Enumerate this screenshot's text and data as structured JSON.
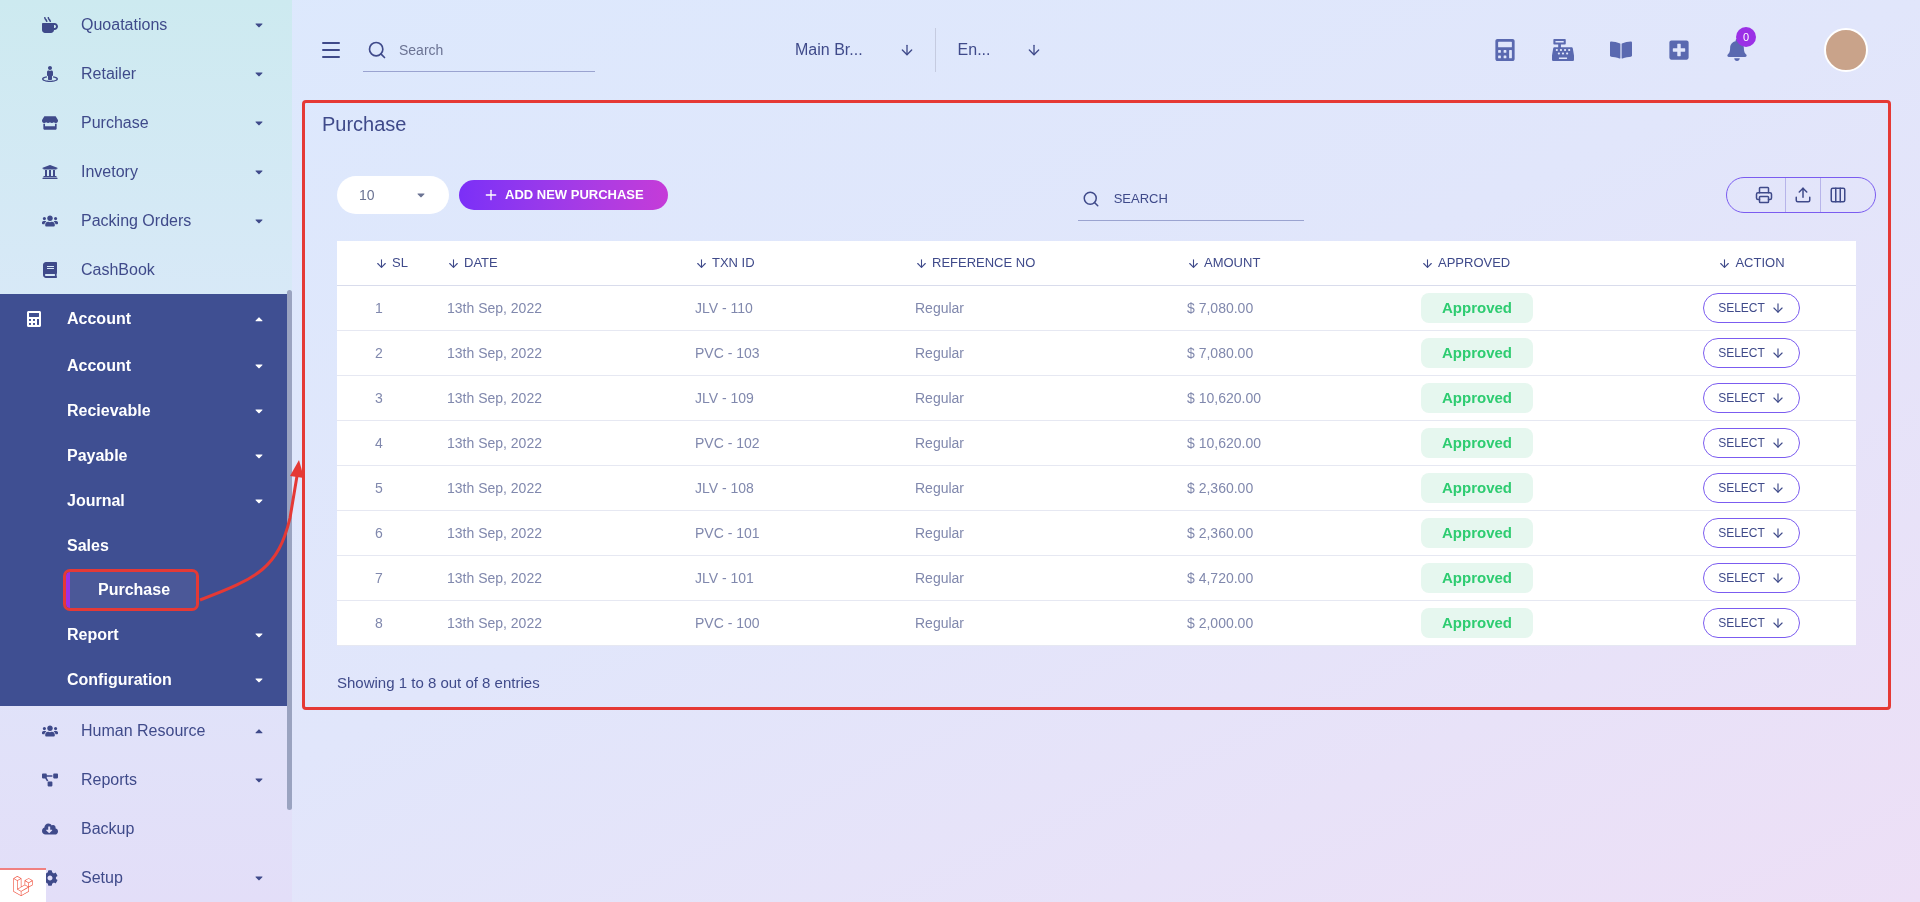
{
  "sidebar": {
    "items": [
      {
        "label": "Quoatations",
        "kind": "group",
        "expanded": false
      },
      {
        "label": "Retailer",
        "kind": "group",
        "expanded": false
      },
      {
        "label": "Purchase",
        "kind": "group",
        "expanded": false
      },
      {
        "label": "Invetory",
        "kind": "group",
        "expanded": false
      },
      {
        "label": "Packing Orders",
        "kind": "group",
        "expanded": false
      },
      {
        "label": "CashBook",
        "kind": "link"
      },
      {
        "label": "Account",
        "kind": "group",
        "expanded": true,
        "children": [
          {
            "label": "Account",
            "kind": "group",
            "expanded": false,
            "selected": false
          },
          {
            "label": "Recievable",
            "kind": "group",
            "expanded": false,
            "selected": false
          },
          {
            "label": "Payable",
            "kind": "group",
            "expanded": false,
            "selected": false
          },
          {
            "label": "Journal",
            "kind": "group",
            "expanded": false,
            "selected": false
          },
          {
            "label": "Sales",
            "kind": "link",
            "selected": false
          },
          {
            "label": "Purchase",
            "kind": "link",
            "selected": true
          },
          {
            "label": "Report",
            "kind": "group",
            "expanded": false,
            "selected": false
          },
          {
            "label": "Configuration",
            "kind": "group",
            "expanded": false,
            "selected": false
          }
        ]
      },
      {
        "label": "Human Resource",
        "kind": "group",
        "expanded": true
      },
      {
        "label": "Reports",
        "kind": "group",
        "expanded": false
      },
      {
        "label": "Backup",
        "kind": "link"
      },
      {
        "label": "Setup",
        "kind": "group",
        "expanded": false
      }
    ]
  },
  "topbar": {
    "search": {
      "placeholder": "Search"
    },
    "branch": "Main Br...",
    "language": "En...",
    "notifications": "0"
  },
  "page": {
    "title": "Purchase",
    "page_size": "10",
    "add_button": "ADD NEW PURCHASE",
    "search": {
      "placeholder": "SEARCH"
    },
    "table": {
      "columns": [
        "SL",
        "DATE",
        "TXN ID",
        "REFERENCE NO",
        "AMOUNT",
        "APPROVED",
        "ACTION"
      ],
      "rows": [
        {
          "sl": "1",
          "date": "13th Sep, 2022",
          "txn": "JLV - 110",
          "ref": "Regular",
          "amount": "$ 7,080.00",
          "status": "Approved",
          "action": "SELECT"
        },
        {
          "sl": "2",
          "date": "13th Sep, 2022",
          "txn": "PVC - 103",
          "ref": "Regular",
          "amount": "$ 7,080.00",
          "status": "Approved",
          "action": "SELECT"
        },
        {
          "sl": "3",
          "date": "13th Sep, 2022",
          "txn": "JLV - 109",
          "ref": "Regular",
          "amount": "$ 10,620.00",
          "status": "Approved",
          "action": "SELECT"
        },
        {
          "sl": "4",
          "date": "13th Sep, 2022",
          "txn": "PVC - 102",
          "ref": "Regular",
          "amount": "$ 10,620.00",
          "status": "Approved",
          "action": "SELECT"
        },
        {
          "sl": "5",
          "date": "13th Sep, 2022",
          "txn": "JLV - 108",
          "ref": "Regular",
          "amount": "$ 2,360.00",
          "status": "Approved",
          "action": "SELECT"
        },
        {
          "sl": "6",
          "date": "13th Sep, 2022",
          "txn": "PVC - 101",
          "ref": "Regular",
          "amount": "$ 2,360.00",
          "status": "Approved",
          "action": "SELECT"
        },
        {
          "sl": "7",
          "date": "13th Sep, 2022",
          "txn": "JLV - 101",
          "ref": "Regular",
          "amount": "$ 4,720.00",
          "status": "Approved",
          "action": "SELECT"
        },
        {
          "sl": "8",
          "date": "13th Sep, 2022",
          "txn": "PVC - 100",
          "ref": "Regular",
          "amount": "$ 2,000.00",
          "status": "Approved",
          "action": "SELECT"
        }
      ]
    },
    "footer": "Showing 1 to 8 out of 8 entries"
  }
}
